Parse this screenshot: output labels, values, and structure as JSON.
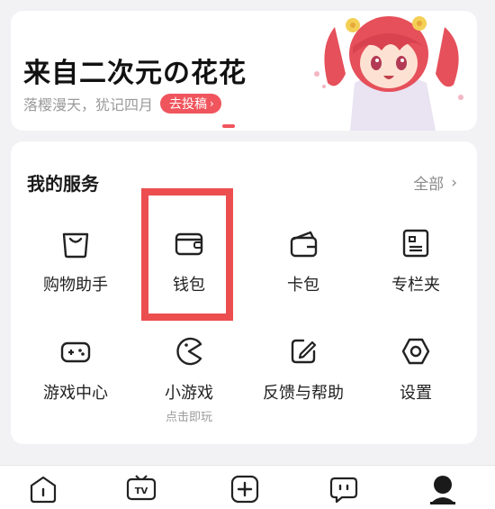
{
  "banner": {
    "title": "来自二次元の花花",
    "subtitle": "落樱漫天，犹记四月",
    "button_label": "去投稿",
    "accent": "#f0555d"
  },
  "services": {
    "title": "我的服务",
    "all_label": "全部",
    "items": [
      {
        "label": "购物助手",
        "icon": "shopping-bag-icon"
      },
      {
        "label": "钱包",
        "icon": "wallet-icon"
      },
      {
        "label": "卡包",
        "icon": "card-pack-icon"
      },
      {
        "label": "专栏夹",
        "icon": "column-folder-icon"
      },
      {
        "label": "游戏中心",
        "icon": "gamepad-icon"
      },
      {
        "label": "小游戏",
        "icon": "pacman-icon",
        "sublabel": "点击即玩"
      },
      {
        "label": "反馈与帮助",
        "icon": "feedback-edit-icon"
      },
      {
        "label": "设置",
        "icon": "settings-hexagon-icon"
      }
    ]
  },
  "tabbar": {
    "tabs": [
      {
        "icon": "home-icon"
      },
      {
        "icon": "tv-icon",
        "glyph": "TV"
      },
      {
        "icon": "add-icon"
      },
      {
        "icon": "message-icon"
      },
      {
        "icon": "profile-icon"
      }
    ]
  },
  "highlight_color": "#ec4e4f"
}
